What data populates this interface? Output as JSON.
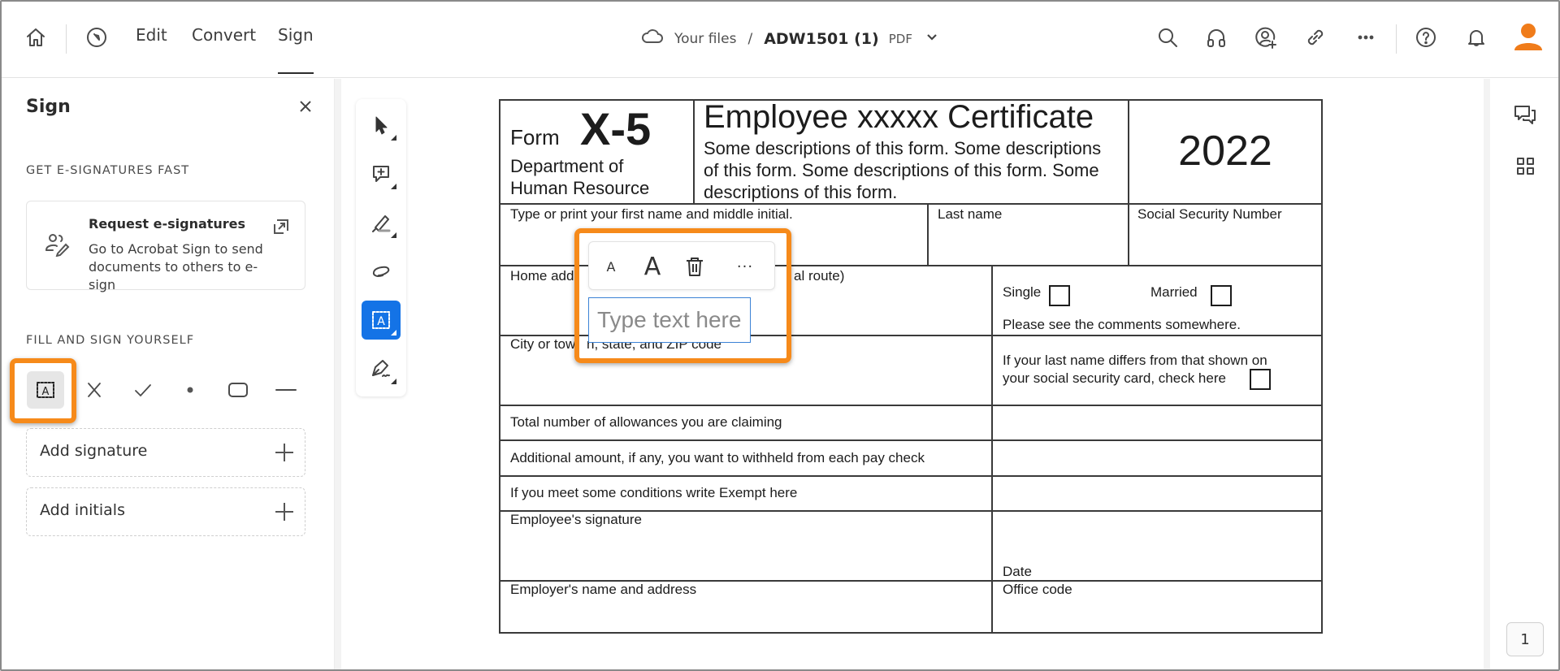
{
  "topbar": {
    "tabs": [
      {
        "label": "Edit",
        "active": false
      },
      {
        "label": "Convert",
        "active": false
      },
      {
        "label": "Sign",
        "active": true
      }
    ],
    "breadcrumb": {
      "location": "Your files",
      "separator": "/",
      "filename": "ADW1501 (1)",
      "filetype": "PDF"
    },
    "icons": [
      "home-icon",
      "compass-icon",
      "search-icon",
      "headphones-icon",
      "share-user-icon",
      "link-icon",
      "more-icon",
      "help-icon",
      "bell-icon",
      "avatar"
    ],
    "avatar_color": "#f07c1a"
  },
  "left_panel": {
    "title": "Sign",
    "section1": "GET E-SIGNATURES FAST",
    "request_card": {
      "title": "Request e-signatures",
      "description": "Go to Acrobat Sign to send documents to others to e-sign"
    },
    "section2": "FILL AND SIGN YOURSELF",
    "tools": [
      "add-text",
      "cross-mark",
      "check-mark",
      "dot",
      "rectangle",
      "line"
    ],
    "selected_tool": "add-text",
    "add_signature": "Add signature",
    "add_initials": "Add initials"
  },
  "vertical_toolbar": {
    "tools": [
      "select",
      "add-comment",
      "highlight",
      "draw",
      "add-text",
      "sign"
    ],
    "active": "add-text"
  },
  "form": {
    "form_word": "Form",
    "form_id": "X-5",
    "department": "Department of",
    "department2": "Human Resource",
    "title": "Employee xxxxx Certificate",
    "desc_lines": [
      "Some descriptions of this form. Some descriptions",
      "of this form. Some descriptions of this form. Some",
      "descriptions of this form."
    ],
    "year": "2022",
    "first_name_label": "Type or print your first name and middle initial.",
    "last_name_label": "Last name",
    "ssn_label": "Social Security Number",
    "home_address_label_start": "Home add",
    "home_address_label_end": "al route)",
    "single_label": "Single",
    "married_label": "Married",
    "comments_note": "Please see the comments somewhere.",
    "city_label_start": "City or tow",
    "city_label_end": "n, state, and ZIP code",
    "last_name_differs_1": "If your last name differs from that shown on",
    "last_name_differs_2": "your social security card, check here",
    "allowances_label": "Total number of allowances you are claiming",
    "additional_amount_label": "Additional amount, if any, you want to withheld from each pay check",
    "exempt_label": "If you meet some conditions write Exempt here",
    "employee_signature_label": "Employee's signature",
    "date_label": "Date",
    "employer_label": "Employer's name and address",
    "office_code_label": "Office code"
  },
  "text_editor": {
    "small_a": "A",
    "large_a": "A",
    "more": "···",
    "placeholder": "Type text here",
    "value": ""
  },
  "right_rail": {
    "icons": [
      "comments-icon",
      "grid-icon"
    ],
    "page_number": "1"
  },
  "highlight_color": "#f68a1a",
  "accent_color": "#1473e6"
}
